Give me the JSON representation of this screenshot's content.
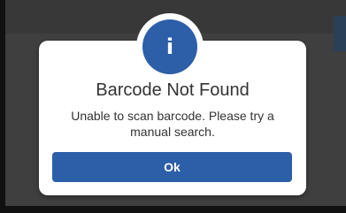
{
  "dialog": {
    "icon": "info-icon",
    "icon_glyph": "i",
    "title": "Barcode Not Found",
    "message": "Unable to scan barcode. Please try a manual search.",
    "ok_label": "Ok"
  },
  "colors": {
    "accent": "#2d5fa8",
    "dialog_background": "#ffffff",
    "overlay": "#3f3f3f",
    "text": "#333333"
  }
}
